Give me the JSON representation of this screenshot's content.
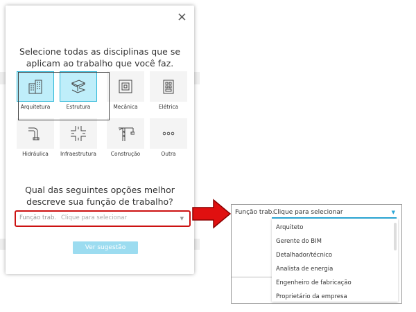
{
  "dialog": {
    "close_symbol": "×",
    "heading1_line1": "Selecione todas as disciplinas que se",
    "heading1_line2": "aplicam ao trabalho que você faz.",
    "heading2_line1": "Qual das seguintes opções melhor",
    "heading2_line2": "descreve sua função de trabalho?",
    "disciplines": [
      {
        "label": "Arquitetura",
        "icon": "building-icon",
        "selected": true
      },
      {
        "label": "Estrutura",
        "icon": "steel-beam-icon",
        "selected": true
      },
      {
        "label": "Mecânica",
        "icon": "concentric-squares-icon",
        "selected": false
      },
      {
        "label": "Elétrica",
        "icon": "electrical-panel-icon",
        "selected": false
      },
      {
        "label": "Hidráulica",
        "icon": "pipe-icon",
        "selected": false
      },
      {
        "label": "Infraestrutura",
        "icon": "road-intersection-icon",
        "selected": false
      },
      {
        "label": "Construção",
        "icon": "crane-icon",
        "selected": false
      },
      {
        "label": "Outra",
        "icon": "more-dots-icon",
        "selected": false
      }
    ],
    "job_select": {
      "label": "Função trab.",
      "placeholder": "Clique para selecionar"
    },
    "suggest_button": "Ver sugestão"
  },
  "panel": {
    "label": "Função trab.",
    "value": "Clique para selecionar",
    "options": [
      "Arquiteto",
      "Gerente do BIM",
      "Detalhador/técnico",
      "Analista de energia",
      "Engenheiro de fabricação",
      "Proprietário da empresa"
    ]
  },
  "colors": {
    "selected_fill": "#bfeefa",
    "selected_border": "#2fb8d8",
    "highlight": "#cc1111",
    "accent": "#2aa7d6",
    "button": "#9cdcf0"
  }
}
